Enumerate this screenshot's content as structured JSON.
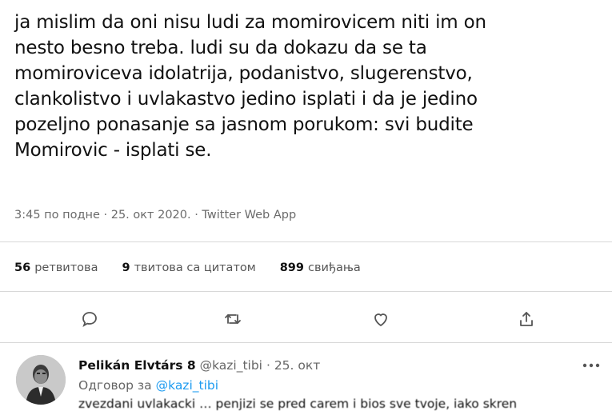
{
  "tweet": {
    "lines": [
      "ja mislim da oni nisu ludi za momirovicem niti im on",
      "nesto besno treba. ludi su da dokazu da se ta",
      "momiroviceva idolatrija, podanistvo, slugerenstvo,",
      "clankolistvo i uvlakastvo jedino isplati i da je jedino",
      "pozeljno ponasanje sa jasnom porukom: svi budite",
      "Momirovic - isplati se."
    ],
    "meta": "3:45 по подне · 25. окт 2020. · Twitter Web App"
  },
  "stats": {
    "retweets_count": "56",
    "retweets_label": "ретвитова",
    "quotes_count": "9",
    "quotes_label": "твитова са цитатом",
    "likes_count": "899",
    "likes_label": "свиђања"
  },
  "actions": [
    "reply-icon",
    "retweet-icon",
    "like-icon",
    "share-icon"
  ],
  "reply": {
    "name": "Pelikán Elvtárs 8",
    "handle": "@kazi_tibi",
    "dot": "·",
    "date": "25. окт",
    "reply_to_prefix": "Одговор за",
    "reply_to_handle": "@kazi_tibi",
    "snippet": "zvezdani uvlakacki … penjizi se pred carem i bios sve tvoje, iako skren"
  },
  "colors": {
    "accent": "#1d9bf0",
    "muted": "#6b6b6b",
    "text": "#111111"
  }
}
